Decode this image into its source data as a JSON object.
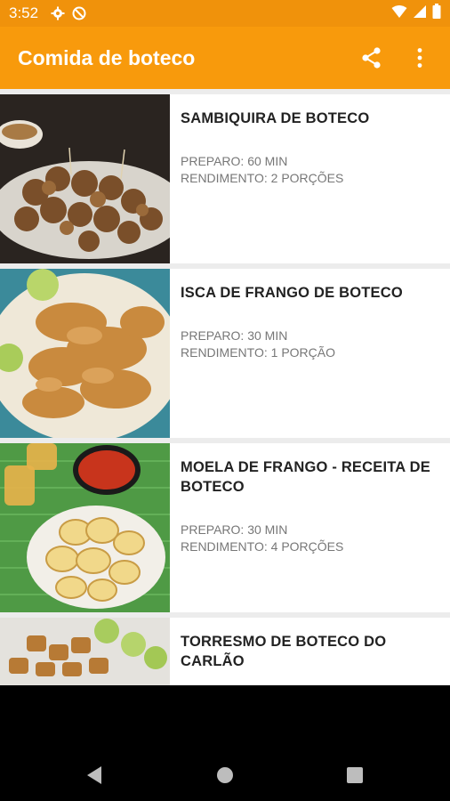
{
  "status_bar": {
    "time": "3:52",
    "left_icons": [
      "gear-icon",
      "do-not-disturb-icon"
    ],
    "right_icons": [
      "wifi-icon",
      "signal-icon",
      "battery-icon"
    ]
  },
  "app_bar": {
    "title": "Comida de boteco",
    "actions": [
      "share-icon",
      "more-vert-icon"
    ]
  },
  "colors": {
    "status_bar": "#f0920b",
    "app_bar": "#f89a0c",
    "list_background": "#ececec",
    "card_background": "#ffffff",
    "title_text": "#222222",
    "meta_text": "#777777"
  },
  "recipes": [
    {
      "title": "SAMBIQUIRA DE BOTECO",
      "prep": "PREPARO: 60 MIN",
      "yield": "RENDIMENTO: 2 PORÇÕES"
    },
    {
      "title": "ISCA DE FRANGO DE BOTECO",
      "prep": "PREPARO: 30 MIN",
      "yield": "RENDIMENTO: 1 PORÇÃO"
    },
    {
      "title": "MOELA DE FRANGO - RECEITA DE BOTECO",
      "prep": "PREPARO: 30 MIN",
      "yield": "RENDIMENTO: 4 PORÇÕES"
    },
    {
      "title": "TORRESMO DE BOTECO DO CARLÃO",
      "prep": "",
      "yield": ""
    }
  ],
  "nav_bar": {
    "buttons": [
      "back-icon",
      "home-icon",
      "recents-icon"
    ]
  }
}
